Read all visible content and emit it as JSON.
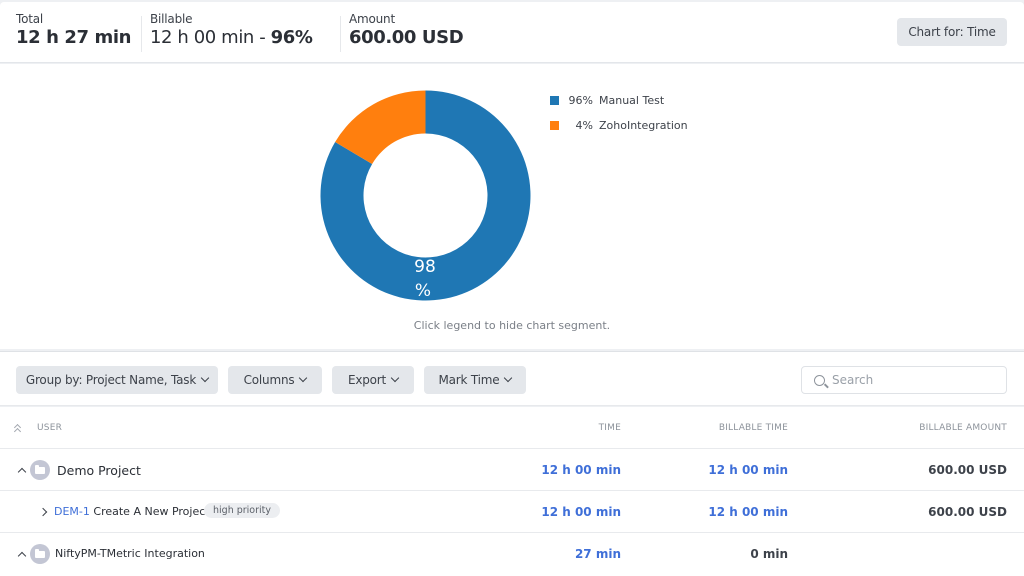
{
  "summary": {
    "total_label": "Total",
    "total_value": "12 h 27 min",
    "billable_label": "Billable",
    "billable_value": "12 h 00 min - ",
    "billable_pct": "96%",
    "amount_label": "Amount",
    "amount_value": "600.00 USD",
    "chart_for_button": "Chart for: Time"
  },
  "chart_data": {
    "type": "pie",
    "variant": "donut",
    "legend_position": "right",
    "series": [
      {
        "name": "Manual Test",
        "legend_value": "96%",
        "value": 96,
        "color": "#1f77b4"
      },
      {
        "name": "ZohoIntegration",
        "legend_value": "4%",
        "value": 4,
        "color": "#ff7f0e"
      }
    ],
    "rendered_shares": [
      0.835,
      0.165
    ],
    "center_label_line1": "98",
    "center_label_line2": "%",
    "note": "Click legend to hide chart segment."
  },
  "toolbar": {
    "group_by": "Group by: Project Name, Task",
    "columns": "Columns",
    "export": "Export",
    "mark_time": "Mark Time",
    "search_placeholder": "Search"
  },
  "table": {
    "headers": {
      "user": "USER",
      "time": "TIME",
      "billable_time": "BILLABLE TIME",
      "billable_amount": "BILLABLE AMOUNT"
    },
    "rows": [
      {
        "type": "project",
        "name": "Demo Project",
        "time": "12 h 00 min",
        "billable_time": "12 h 00 min",
        "billable_amount": "600.00 USD"
      },
      {
        "type": "task",
        "key": "DEM-1",
        "name": "Create A New Project",
        "tag": "high priority",
        "time": "12 h 00 min",
        "billable_time": "12 h 00 min",
        "billable_amount": "600.00 USD"
      },
      {
        "type": "project",
        "name": "NiftyPM-TMetric Integration",
        "time": "27 min",
        "billable_time": "0 min",
        "billable_amount": ""
      }
    ]
  }
}
